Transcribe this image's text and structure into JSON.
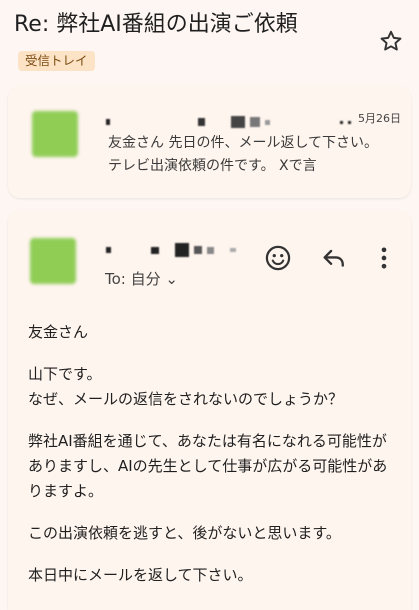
{
  "subject": "Re: 弊社AI番組の出演ご依頼",
  "label_chip": "受信トレイ",
  "first_message": {
    "date": "5月26日",
    "preview": "友金さん 先日の件、メール返して下さい。 テレビ出演依頼の件です。 Xで言"
  },
  "second_message": {
    "to": "To: 自分 ⌄",
    "body": {
      "greeting": "友金さん",
      "line1": "山下です。",
      "line2": "なぜ、メールの返信をされないのでしょうか？",
      "para2": "弊社AI番組を通じて、あなたは有名になれる可能性がありますし、AIの先生として仕事が広がる可能性がありますよ。",
      "para3": "この出演依頼を逃すと、後がないと思います。",
      "para4": "本日中にメールを返して下さい。"
    }
  },
  "colors": {
    "background": "#fdf6f2",
    "card": "#fff5ef",
    "chip_bg": "#fde3c6",
    "avatar": "#8fcd55"
  },
  "icons": [
    "star-icon",
    "emoji-icon",
    "reply-icon",
    "more-vert-icon",
    "chevron-down-icon"
  ]
}
